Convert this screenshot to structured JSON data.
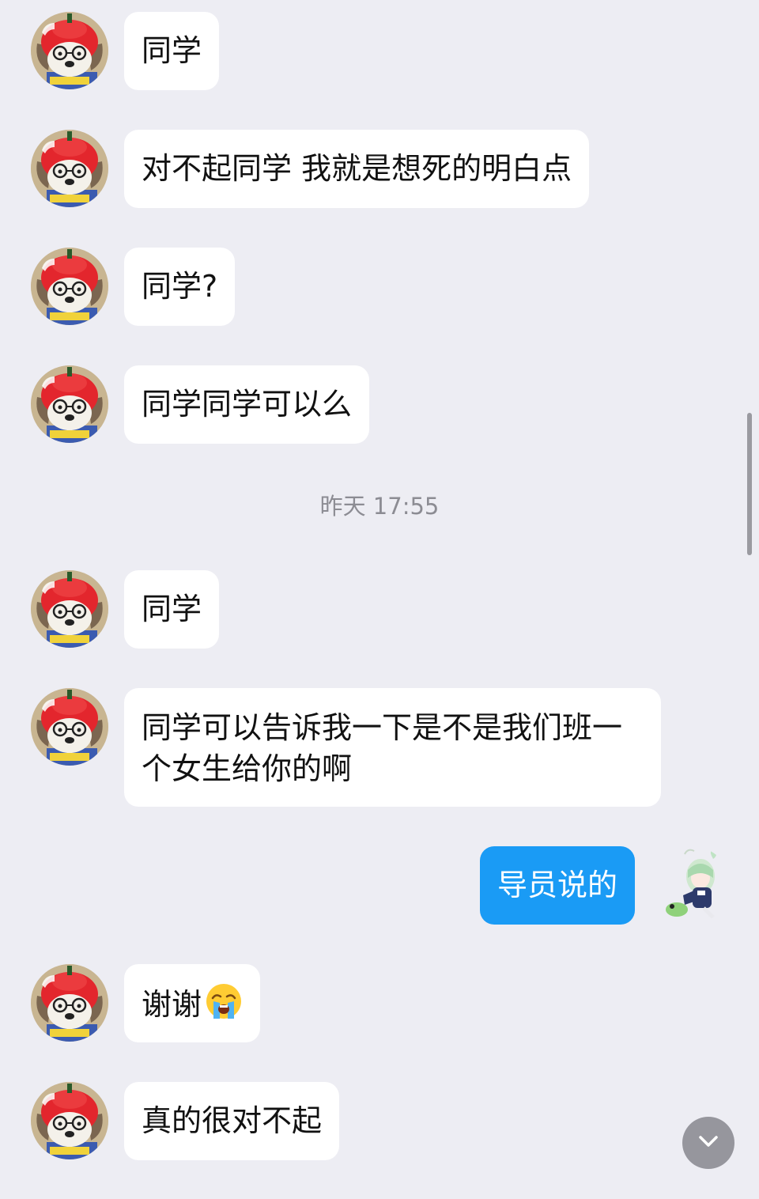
{
  "conversation": {
    "messages_before": [
      {
        "text": "同学"
      },
      {
        "text": "对不起同学 我就是想死的明白点"
      },
      {
        "text": "同学?"
      },
      {
        "text": "同学同学可以么"
      }
    ],
    "timestamp": "昨天 17:55",
    "messages_after": [
      {
        "text": "同学"
      },
      {
        "text": "同学可以告诉我一下是不是我们班一个女生给你的啊"
      },
      {
        "text": "导员说的"
      },
      {
        "text": "谢谢",
        "emoji": "loudly-crying-face-emoji"
      },
      {
        "text": "真的很对不起"
      }
    ]
  },
  "icons": {
    "peer_avatar": "red-hat-plush-dog-avatar",
    "self_avatar": "anime-girl-avatar",
    "scroll_down": "chevron-down-icon"
  },
  "colors": {
    "background": "#ededf3",
    "incoming_bubble": "#ffffff",
    "outgoing_bubble": "#1a9bf5",
    "timestamp_text": "#8c8c93"
  }
}
